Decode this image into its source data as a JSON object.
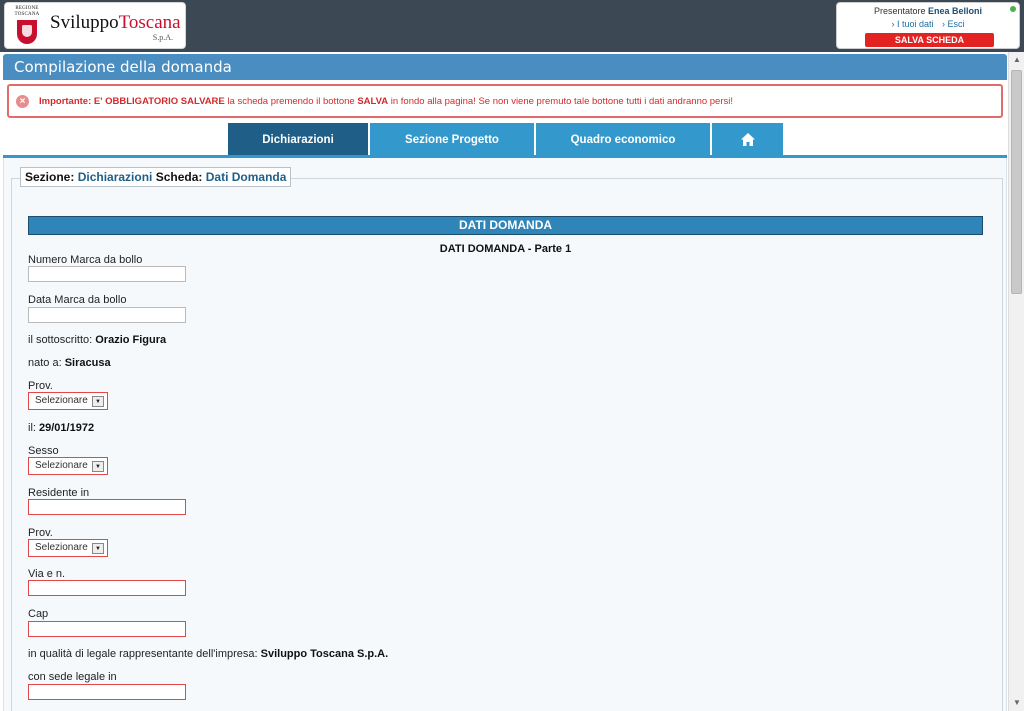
{
  "header": {
    "logo": {
      "emblem_text": "REGIONE TOSCANA",
      "name_part1": "Sviluppo",
      "name_part2": "Toscana",
      "suffix": "S.p.A."
    },
    "user": {
      "prefix": "Presentatore",
      "name": "Enea Belloni",
      "link_mydata": "› I tuoi dati",
      "link_exit": "› Esci",
      "save_label": "SALVA SCHEDA"
    }
  },
  "page": {
    "title": "Compilazione della domanda"
  },
  "warning": {
    "prefix": "Importante: E' OBBLIGATORIO SALVARE",
    "mid1": " la scheda premendo il bottone ",
    "salva": "SALVA",
    "rest": " in fondo alla pagina! Se non viene premuto tale bottone tutti i dati andranno persi!"
  },
  "tabs": {
    "t1": "Dichiarazioni",
    "t2": "Sezione Progetto",
    "t3": "Quadro economico",
    "home_icon": "home-icon"
  },
  "legend": {
    "section_label": "Sezione:",
    "section_value": "Dichiarazioni",
    "card_label": "Scheda:",
    "card_value": "Dati Domanda"
  },
  "form": {
    "header": "DATI DOMANDA",
    "subheader": "DATI DOMANDA - Parte 1",
    "marca_label": "Numero Marca da bollo",
    "marca_value": "",
    "data_marca_label": "Data Marca da bollo",
    "data_marca_value": "",
    "sottoscritto_label": "il sottoscritto:",
    "sottoscritto_value": "Orazio Figura",
    "nato_label": "nato a:",
    "nato_value": "Siracusa",
    "prov_label": "Prov.",
    "prov_value": "Selezionare",
    "il_label": "il:",
    "il_value": "29/01/1972",
    "sesso_label": "Sesso",
    "sesso_value": "Selezionare",
    "residente_label": "Residente in",
    "residente_value": "",
    "prov2_label": "Prov.",
    "prov2_value": "Selezionare",
    "via_label": "Via e n.",
    "via_value": "",
    "cap_label": "Cap",
    "cap_value": "",
    "qualita_label": "in qualità di legale rappresentante dell'impresa:",
    "qualita_value": "Sviluppo Toscana S.p.A.",
    "sede_label": "con sede legale in",
    "sede_value": ""
  },
  "colors": {
    "topbar": "#3c4954",
    "title_bar": "#4a8dc0",
    "tab": "#3399cc",
    "tab_active": "#1f5f87",
    "required_border": "#e24848",
    "warning_text": "#d12b2b"
  }
}
